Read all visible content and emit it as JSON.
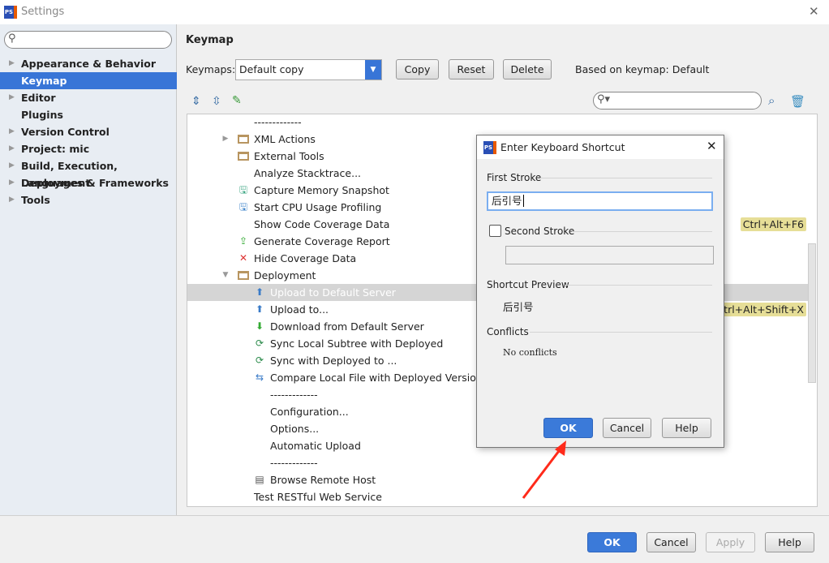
{
  "window": {
    "title": "Settings",
    "close": "✕"
  },
  "sidebar": {
    "search_placeholder": "",
    "items": [
      {
        "label": "Appearance & Behavior",
        "expandable": true
      },
      {
        "label": "Keymap",
        "selected": true
      },
      {
        "label": "Editor",
        "expandable": true
      },
      {
        "label": "Plugins"
      },
      {
        "label": "Version Control",
        "expandable": true
      },
      {
        "label": "Project: mic",
        "expandable": true
      },
      {
        "label": "Build, Execution, Deployment",
        "expandable": true
      },
      {
        "label": "Languages & Frameworks",
        "expandable": true
      },
      {
        "label": "Tools",
        "expandable": true
      }
    ]
  },
  "keymap": {
    "heading": "Keymap",
    "keymaps_label": "Keymaps:",
    "selected": "Default copy",
    "copy": "Copy",
    "reset": "Reset",
    "delete": "Delete",
    "based_on": "Based on keymap: Default",
    "filter_value": ""
  },
  "tree": [
    {
      "label": "-------------",
      "level": 1
    },
    {
      "label": "XML Actions",
      "level": 1,
      "icon": "folder",
      "expander": "▶"
    },
    {
      "label": "External Tools",
      "level": 1,
      "icon": "folder"
    },
    {
      "label": "Analyze Stacktrace...",
      "level": 1
    },
    {
      "label": "Capture Memory Snapshot",
      "level": 1,
      "icon": "memory"
    },
    {
      "label": "Start CPU Usage Profiling",
      "level": 1,
      "icon": "cpu"
    },
    {
      "label": "Show Code Coverage Data",
      "level": 1,
      "shortcut": "Ctrl+Alt+F6"
    },
    {
      "label": "Generate Coverage Report",
      "level": 1,
      "icon": "report"
    },
    {
      "label": "Hide Coverage Data",
      "level": 1,
      "icon": "close"
    },
    {
      "label": "Deployment",
      "level": 1,
      "icon": "folder",
      "expander": "▼"
    },
    {
      "label": "Upload to Default Server",
      "level": 2,
      "icon": "upload",
      "selected": true
    },
    {
      "label": "Upload to...",
      "level": 2,
      "icon": "upload",
      "shortcut": "Ctrl+Alt+Shift+X"
    },
    {
      "label": "Download from Default Server",
      "level": 2,
      "icon": "download"
    },
    {
      "label": "Sync Local Subtree with Deployed",
      "level": 2,
      "icon": "sync"
    },
    {
      "label": "Sync with Deployed to ...",
      "level": 2,
      "icon": "sync"
    },
    {
      "label": "Compare Local File with Deployed Version",
      "level": 2,
      "icon": "compare"
    },
    {
      "label": "-------------",
      "level": 2
    },
    {
      "label": "Configuration...",
      "level": 2
    },
    {
      "label": "Options...",
      "level": 2
    },
    {
      "label": "Automatic Upload",
      "level": 2
    },
    {
      "label": "-------------",
      "level": 2
    },
    {
      "label": "Browse Remote Host",
      "level": 2,
      "icon": "server"
    },
    {
      "label": "Test RESTful Web Service",
      "level": 1
    }
  ],
  "dialog": {
    "title": "Enter Keyboard Shortcut",
    "first_stroke": "First Stroke",
    "first_value": "后引号",
    "second_stroke": "Second Stroke",
    "second_checked": false,
    "second_value": "",
    "preview_label": "Shortcut Preview",
    "preview_value": "后引号",
    "conflicts_label": "Conflicts",
    "conflicts_value": "No conflicts",
    "ok": "OK",
    "cancel": "Cancel",
    "help": "Help"
  },
  "footer": {
    "ok": "OK",
    "cancel": "Cancel",
    "apply": "Apply",
    "help": "Help"
  },
  "colors": {
    "accent": "#3875d7",
    "shortcut_bg": "#e6de97",
    "annotation_arrow": "#ff2a1a"
  }
}
